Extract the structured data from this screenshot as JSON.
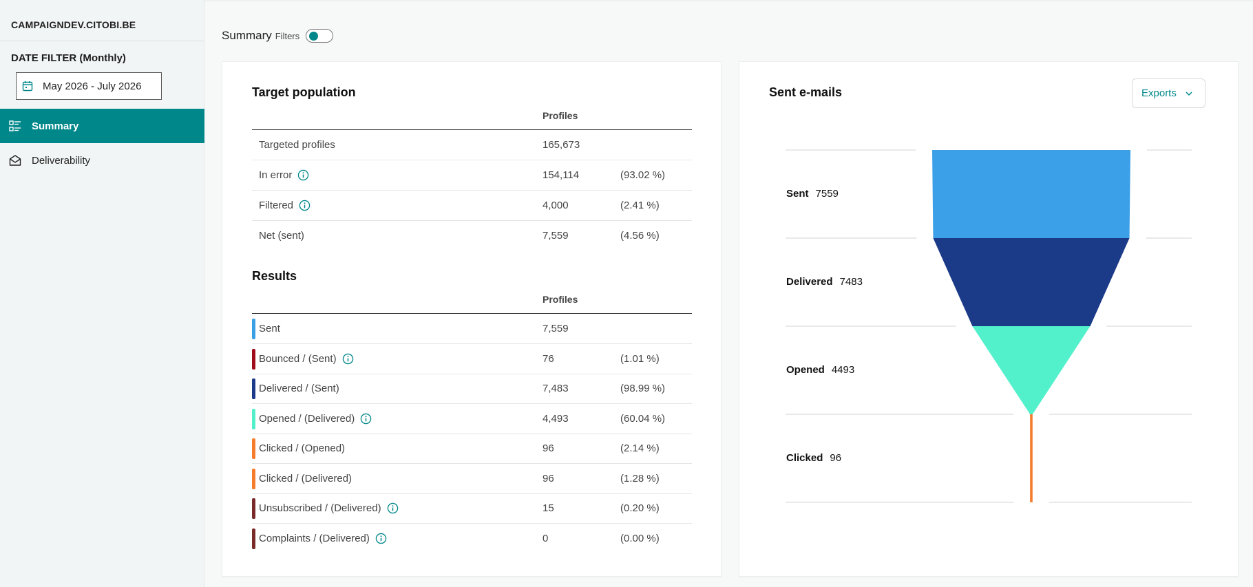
{
  "sidebar": {
    "org_name": "CAMPAIGNDEV.CITOBI.BE",
    "date_filter_label": "DATE FILTER (Monthly)",
    "date_range": "May 2026 - July 2026",
    "nav": [
      {
        "label": "Summary",
        "icon": "list-icon",
        "active": true
      },
      {
        "label": "Deliverability",
        "icon": "mail-open-icon",
        "active": false
      }
    ]
  },
  "header": {
    "title": "Summary",
    "filters_label": "Filters"
  },
  "target": {
    "title": "Target population",
    "col_profiles": "Profiles",
    "rows": [
      {
        "label": "Targeted profiles",
        "value": "165,673",
        "pct": ""
      },
      {
        "label": "In error",
        "value": "154,114",
        "pct": "(93.02 %)"
      },
      {
        "label": "Filtered",
        "value": "4,000",
        "pct": "(2.41 %)"
      },
      {
        "label": "Net (sent)",
        "value": "7,559",
        "pct": "(4.56 %)"
      }
    ]
  },
  "results": {
    "title": "Results",
    "col_profiles": "Profiles",
    "rows": [
      {
        "label": "Sent",
        "value": "7,559",
        "pct": "",
        "color": "#3b9fe6"
      },
      {
        "label": "Bounced / (Sent)",
        "value": "76",
        "pct": "(1.01 %)",
        "color": "#a00c1c"
      },
      {
        "label": "Delivered / (Sent)",
        "value": "7,483",
        "pct": "(98.99 %)",
        "color": "#1b3a89"
      },
      {
        "label": "Opened / (Delivered)",
        "value": "4,493",
        "pct": "(60.04 %)",
        "color": "#53efcb"
      },
      {
        "label": "Clicked / (Opened)",
        "value": "96",
        "pct": "(2.14 %)",
        "color": "#f47c2c"
      },
      {
        "label": "Clicked / (Delivered)",
        "value": "96",
        "pct": "(1.28 %)",
        "color": "#f47c2c"
      },
      {
        "label": "Unsubscribed / (Delivered)",
        "value": "15",
        "pct": "(0.20 %)",
        "color": "#7b2a2a"
      },
      {
        "label": "Complaints / (Delivered)",
        "value": "0",
        "pct": "(0.00 %)",
        "color": "#7b2a2a"
      }
    ]
  },
  "funnel": {
    "title": "Sent e-mails",
    "exports_label": "Exports",
    "stages": [
      {
        "name": "Sent",
        "value": 7559,
        "color": "#3ba0e8"
      },
      {
        "name": "Delivered",
        "value": 7483,
        "color": "#1b3a87"
      },
      {
        "name": "Opened",
        "value": 4493,
        "color": "#52f0cb"
      },
      {
        "name": "Clicked",
        "value": 96,
        "color": "#f47c2c"
      }
    ]
  },
  "colors": {
    "accent": "#00878a"
  }
}
